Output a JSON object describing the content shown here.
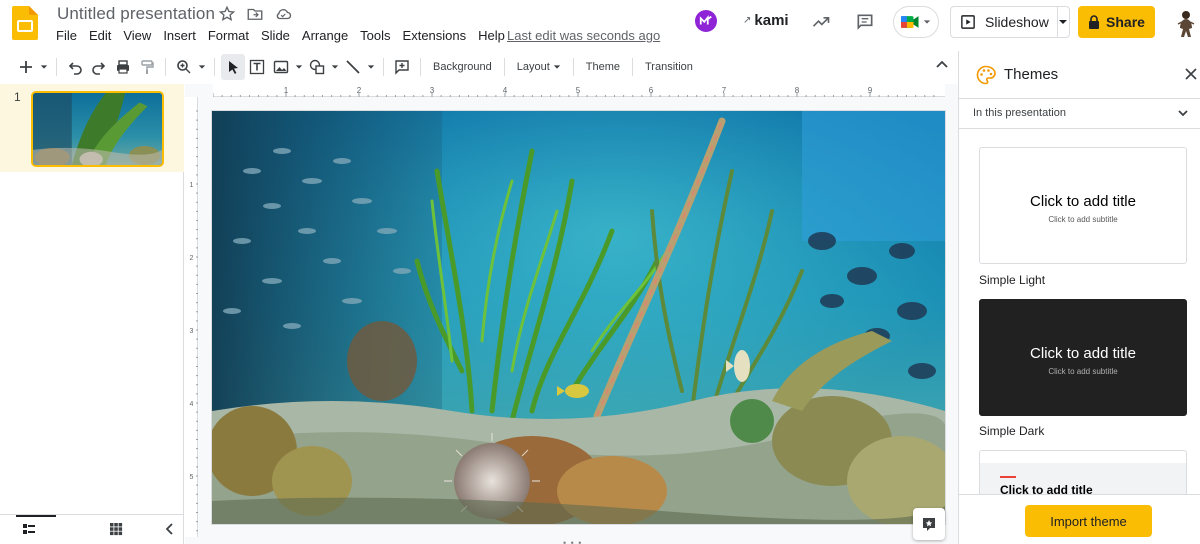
{
  "doc": {
    "title": "Untitled presentation",
    "last_edit": "Last edit was seconds ago"
  },
  "menu": [
    "File",
    "Edit",
    "View",
    "Insert",
    "Format",
    "Slide",
    "Arrange",
    "Tools",
    "Extensions",
    "Help"
  ],
  "header_right": {
    "kami_label": "kami",
    "slideshow_label": "Slideshow",
    "share_label": "Share"
  },
  "toolbar": {
    "background_label": "Background",
    "layout_label": "Layout",
    "theme_label": "Theme",
    "transition_label": "Transition"
  },
  "filmstrip": {
    "slides": [
      {
        "number": "1",
        "selected": true
      }
    ]
  },
  "ruler": {
    "horizontal_labels": [
      "1",
      "2",
      "3",
      "4",
      "5",
      "6",
      "7",
      "8",
      "9"
    ],
    "vertical_labels": [
      "1",
      "2",
      "3",
      "4",
      "5"
    ]
  },
  "themes_panel": {
    "title": "Themes",
    "section_label": "In this presentation",
    "themes": [
      {
        "name": "Simple Light",
        "title_text": "Click to add title",
        "subtitle_text": "Click to add subtitle"
      },
      {
        "name": "Simple Dark",
        "title_text": "Click to add title",
        "subtitle_text": "Click to add subtitle"
      },
      {
        "name": "",
        "title_text": "Click to add title",
        "subtitle_text": ""
      }
    ],
    "import_label": "Import theme"
  },
  "colors": {
    "accent": "#fbbc04",
    "filmstrip_selected": "#fef7e0",
    "kami": "#8e24d6"
  }
}
